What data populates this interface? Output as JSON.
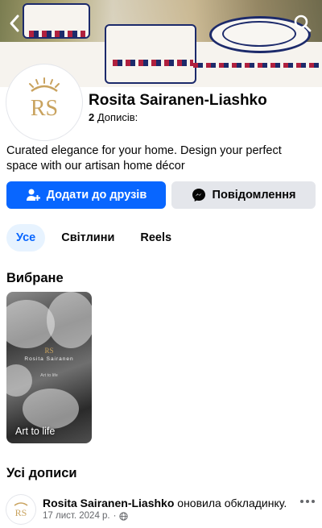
{
  "header": {
    "back_icon": "chevron-left-icon",
    "search_icon": "search-icon"
  },
  "profile": {
    "name": "Rosita Sairanen-Liashko",
    "posts_count": "2",
    "posts_label": "Дописів:",
    "avatar_monogram": "RS",
    "bio": "Curated elegance for your home. Design your perfect space with our artisan home décor",
    "brand_color": "#c9a35f"
  },
  "actions": {
    "add_friend_label": "Додати до друзів",
    "message_label": "Повідомлення",
    "primary_color": "#0866ff"
  },
  "tabs": [
    {
      "label": "Усе",
      "active": true
    },
    {
      "label": "Світлини",
      "active": false
    },
    {
      "label": "Reels",
      "active": false
    }
  ],
  "featured": {
    "title": "Вибране",
    "items": [
      {
        "logo_monogram": "RS",
        "logo_name": "Rosita Sairanen",
        "logo_tagline": "Art to life",
        "caption": "Art to life"
      }
    ]
  },
  "posts_section": {
    "title": "Усі дописи",
    "items": [
      {
        "author": "Rosita Sairanen-Liashko",
        "action": "оновила обкладинку.",
        "date": "17 лист. 2024 р.",
        "separator": "·",
        "privacy_icon": "globe-icon",
        "more_icon": "more-dots-icon"
      }
    ]
  }
}
